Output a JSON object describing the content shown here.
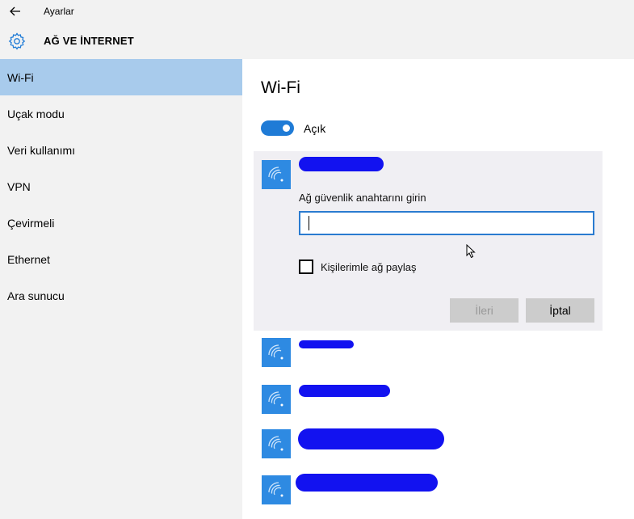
{
  "window": {
    "title": "Ayarlar"
  },
  "header": {
    "section_title": "AĞ VE İNTERNET"
  },
  "sidebar": {
    "items": [
      {
        "label": "Wi-Fi",
        "selected": true
      },
      {
        "label": "Uçak modu"
      },
      {
        "label": "Veri kullanımı"
      },
      {
        "label": "VPN"
      },
      {
        "label": "Çevirmeli"
      },
      {
        "label": "Ethernet"
      },
      {
        "label": "Ara sunucu"
      }
    ]
  },
  "main": {
    "title": "Wi-Fi",
    "toggle": {
      "label": "Açık",
      "on": true
    },
    "connect_panel": {
      "key_label": "Ağ güvenlik anahtarını girin",
      "key_value": "",
      "share_label": "Kişilerimle ağ paylaş",
      "share_checked": false,
      "next_label": "İleri",
      "cancel_label": "İptal"
    },
    "networks_count_visible": 5
  },
  "colors": {
    "accent": "#1f7bd6",
    "selection": "#a8cbec",
    "tile": "#2e8ae2",
    "redaction": "#1212f0"
  },
  "icons": {
    "back": "back-arrow-icon",
    "header": "gear-icon",
    "network": "wifi-signal-icon"
  }
}
